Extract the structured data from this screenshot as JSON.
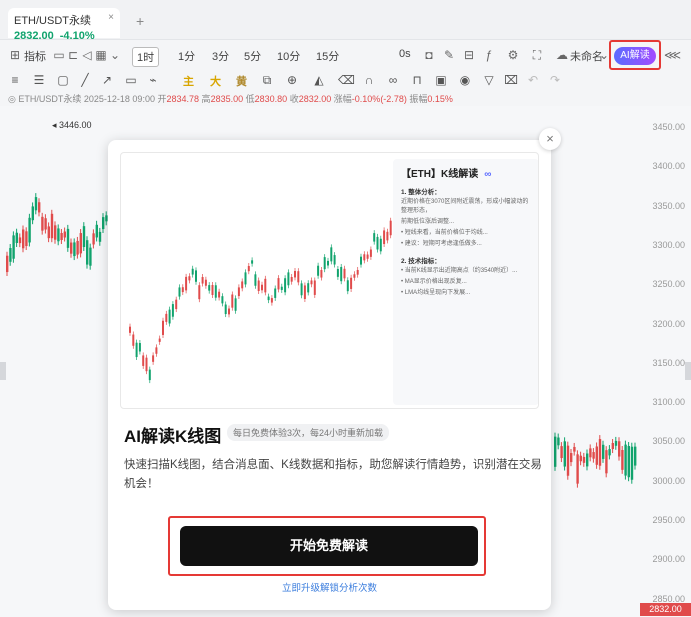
{
  "tab": {
    "symbol": "ETH/USDT永续",
    "price": "2832.00",
    "change": "-4.10%",
    "close_glyph": "×",
    "add_glyph": "+"
  },
  "toolbar": {
    "indicator": "指标",
    "interval_selected": "1时",
    "intervals": [
      "1分",
      "3分",
      "5分",
      "10分",
      "15分"
    ],
    "zero_s": "0s",
    "layout_name": "未命名",
    "ai_button": "AI解读"
  },
  "drawing_colors": {
    "zhu": "主",
    "da": "大",
    "huang": "黄"
  },
  "info_line": {
    "symbol": "ETH/USDT永续",
    "datetime": "2025-12-18 09:00",
    "open_label": "开",
    "open": "2834.78",
    "high_label": "高",
    "high": "2835.00",
    "low_label": "低",
    "low": "2830.80",
    "close_label": "收",
    "close": "2832.00",
    "amp_label": "涨幅",
    "amp": "-0.10%(-2.78)",
    "range_label": "振幅",
    "range": "0.15%"
  },
  "chart": {
    "high_marker": "3446.00",
    "price_ticks": [
      "3450.00",
      "3400.00",
      "3350.00",
      "3300.00",
      "3250.00",
      "3200.00",
      "3150.00",
      "3100.00",
      "3050.00",
      "3000.00",
      "2950.00",
      "2900.00",
      "2850.00"
    ],
    "last_price": "2832.00",
    "up_color": "#11a36d",
    "down_color": "#e04b4b"
  },
  "modal": {
    "close": "×",
    "preview": {
      "title": "【ETH】K线解读",
      "bot_icon": "∞",
      "sections": [
        {
          "head": "1. 整体分析：",
          "lines": [
            "近期价格在3070区间附近震荡，形成小幅波动的整理形态，",
            "前期低位涨后调整..."
          ]
        },
        {
          "head": "",
          "lines": [
            "• 短线来看，当前价格位于均线...",
            "• 建议：短期可考虑逢低做多..."
          ]
        },
        {
          "head": "2. 技术指标：",
          "lines": [
            "• 当前K线显示出近期高点（约3540附近）...",
            "• MA显示价格出现反复...",
            "• LMA均线呈现向下发展..."
          ]
        }
      ]
    },
    "title": "AI解读K线图",
    "badge": "每日免费体验3次，每24小时重新加载",
    "description": "快速扫描K线图，结合消息面、K线数据和指标，助您解读行情趋势，识别潜在交易机会！",
    "cta": "开始免费解读",
    "link": "立即升级解锁分析次数"
  }
}
